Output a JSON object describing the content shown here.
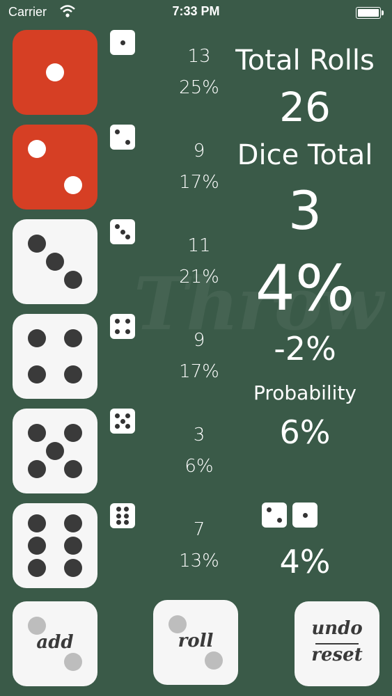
{
  "status_bar": {
    "carrier": "Carrier",
    "time": "7:33 PM"
  },
  "watermark": "Throw",
  "faces": [
    {
      "face": 1,
      "count": "13",
      "percent": "25%",
      "highlighted": true
    },
    {
      "face": 2,
      "count": "9",
      "percent": "17%",
      "highlighted": true
    },
    {
      "face": 3,
      "count": "11",
      "percent": "21%",
      "highlighted": false
    },
    {
      "face": 4,
      "count": "9",
      "percent": "17%",
      "highlighted": false
    },
    {
      "face": 5,
      "count": "3",
      "percent": "6%",
      "highlighted": false
    },
    {
      "face": 6,
      "count": "7",
      "percent": "13%",
      "highlighted": false
    }
  ],
  "stats": {
    "total_rolls_label": "Total Rolls",
    "total_rolls": "26",
    "dice_total_label": "Dice Total",
    "dice_total": "3",
    "dice_total_percent": "4%",
    "difference": "-2%",
    "probability_label": "Probability",
    "probability": "6%",
    "pair_percent": "4%"
  },
  "buttons": {
    "add": "add",
    "roll": "roll",
    "undo": "undo",
    "reset": "reset"
  },
  "colors": {
    "background": "#3a5a48",
    "highlight": "#d63f24",
    "die": "#f6f6f6",
    "pip": "#3a3a3a"
  }
}
